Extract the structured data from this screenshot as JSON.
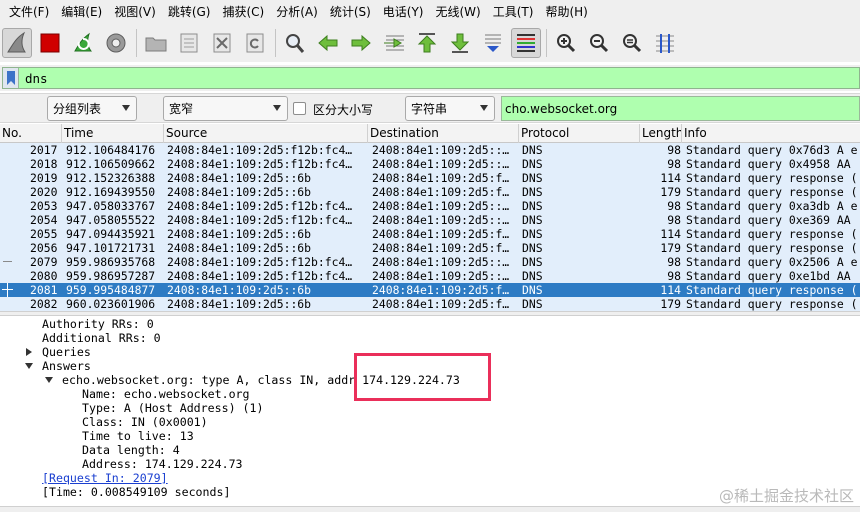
{
  "menubar": {
    "items": [
      "文件(F)",
      "编辑(E)",
      "视图(V)",
      "跳转(G)",
      "捕获(C)",
      "分析(A)",
      "统计(S)",
      "电话(Y)",
      "无线(W)",
      "工具(T)",
      "帮助(H)"
    ]
  },
  "toolbar": {
    "icons": [
      "shark-fin-icon",
      "stop-capture-icon",
      "restart-capture-icon",
      "capture-options-icon",
      "open-file-icon",
      "save-file-icon",
      "close-file-icon",
      "reload-file-icon",
      "find-packet-icon",
      "go-back-icon",
      "go-forward-icon",
      "go-to-packet-icon",
      "go-first-icon",
      "go-last-icon",
      "autoscroll-icon",
      "colorize-icon",
      "zoom-in-icon",
      "zoom-out-icon",
      "zoom-normal-icon",
      "resize-columns-icon"
    ]
  },
  "display_filter": {
    "value": "dns"
  },
  "find_bar": {
    "search_in": "分组列表",
    "char_width": "宽窄",
    "case_label": "区分大小写",
    "case_checked": false,
    "search_type": "字符串",
    "search_value": "cho.websocket.org"
  },
  "packet_list": {
    "columns": [
      "No.",
      "Time",
      "Source",
      "Destination",
      "Protocol",
      "Length",
      "Info"
    ],
    "rows": [
      {
        "no": "2017",
        "time": "912.106484176",
        "source": "2408:84e1:109:2d5:f12b:fc4…",
        "destination": "2408:84e1:109:2d5::…",
        "protocol": "DNS",
        "length": "98",
        "info": "Standard query 0x76d3 A e",
        "selected": false
      },
      {
        "no": "2018",
        "time": "912.106509662",
        "source": "2408:84e1:109:2d5:f12b:fc4…",
        "destination": "2408:84e1:109:2d5::…",
        "protocol": "DNS",
        "length": "98",
        "info": "Standard query 0x4958 AA",
        "selected": false
      },
      {
        "no": "2019",
        "time": "912.152326388",
        "source": "2408:84e1:109:2d5::6b",
        "destination": "2408:84e1:109:2d5:f…",
        "protocol": "DNS",
        "length": "114",
        "info": "Standard query response (",
        "selected": false
      },
      {
        "no": "2020",
        "time": "912.169439550",
        "source": "2408:84e1:109:2d5::6b",
        "destination": "2408:84e1:109:2d5:f…",
        "protocol": "DNS",
        "length": "179",
        "info": "Standard query response (",
        "selected": false
      },
      {
        "no": "2053",
        "time": "947.058033767",
        "source": "2408:84e1:109:2d5:f12b:fc4…",
        "destination": "2408:84e1:109:2d5::…",
        "protocol": "DNS",
        "length": "98",
        "info": "Standard query 0xa3db A e",
        "selected": false
      },
      {
        "no": "2054",
        "time": "947.058055522",
        "source": "2408:84e1:109:2d5:f12b:fc4…",
        "destination": "2408:84e1:109:2d5::…",
        "protocol": "DNS",
        "length": "98",
        "info": "Standard query 0xe369 AA",
        "selected": false
      },
      {
        "no": "2055",
        "time": "947.094435921",
        "source": "2408:84e1:109:2d5::6b",
        "destination": "2408:84e1:109:2d5:f…",
        "protocol": "DNS",
        "length": "114",
        "info": "Standard query response (",
        "selected": false
      },
      {
        "no": "2056",
        "time": "947.101721731",
        "source": "2408:84e1:109:2d5::6b",
        "destination": "2408:84e1:109:2d5:f…",
        "protocol": "DNS",
        "length": "179",
        "info": "Standard query response (",
        "selected": false
      },
      {
        "no": "2079",
        "time": "959.986935768",
        "source": "2408:84e1:109:2d5:f12b:fc4…",
        "destination": "2408:84e1:109:2d5::…",
        "protocol": "DNS",
        "length": "98",
        "info": "Standard query 0x2506 A e",
        "selected": false
      },
      {
        "no": "2080",
        "time": "959.986957287",
        "source": "2408:84e1:109:2d5:f12b:fc4…",
        "destination": "2408:84e1:109:2d5::…",
        "protocol": "DNS",
        "length": "98",
        "info": "Standard query 0xe1bd AA",
        "selected": false
      },
      {
        "no": "2081",
        "time": "959.995484877",
        "source": "2408:84e1:109:2d5::6b",
        "destination": "2408:84e1:109:2d5:f…",
        "protocol": "DNS",
        "length": "114",
        "info": "Standard query response (",
        "selected": true
      },
      {
        "no": "2082",
        "time": "960.023601906",
        "source": "2408:84e1:109:2d5::6b",
        "destination": "2408:84e1:109:2d5:f…",
        "protocol": "DNS",
        "length": "179",
        "info": "Standard query response (",
        "selected": false
      }
    ]
  },
  "details": {
    "authority_rrs": "Authority RRs: 0",
    "additional_rrs": "Additional RRs: 0",
    "queries": "Queries",
    "answers": "Answers",
    "answer_summary": "echo.websocket.org: type A, class IN, addr 174.129.224.73",
    "name": "Name: echo.websocket.org",
    "type": "Type: A (Host Address) (1)",
    "class": "Class: IN (0x0001)",
    "ttl": "Time to live: 13",
    "data_length": "Data length: 4",
    "address": "Address: 174.129.224.73",
    "request_in": "[Request In: 2079]",
    "time": "[Time: 0.008549109 seconds]"
  },
  "watermark": "@稀土掘金技术社区",
  "colors": {
    "row_bg": "#e2eefb",
    "selected_row_bg": "#2d7bc4",
    "filter_valid_bg": "#afffaf",
    "highlight_box": "#ea2f5a"
  }
}
